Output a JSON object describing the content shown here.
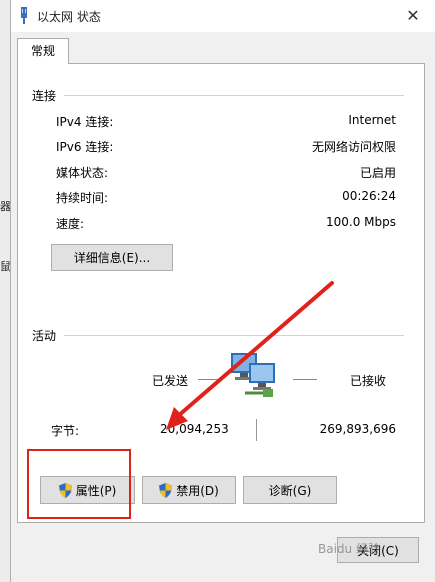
{
  "window": {
    "title": "以太网 状态",
    "close_glyph": "✕"
  },
  "tab": {
    "label": "常规"
  },
  "connection": {
    "heading": "连接",
    "rows": [
      {
        "label": "IPv4 连接:",
        "value": "Internet"
      },
      {
        "label": "IPv6 连接:",
        "value": "无网络访问权限"
      },
      {
        "label": "媒体状态:",
        "value": "已启用"
      },
      {
        "label": "持续时间:",
        "value": "00:26:24"
      },
      {
        "label": "速度:",
        "value": "100.0 Mbps"
      }
    ],
    "details_button": "详细信息(E)..."
  },
  "activity": {
    "heading": "活动",
    "sent_label": "已发送",
    "received_label": "已接收",
    "bytes_label": "字节:",
    "bytes_sent": "20,094,253",
    "bytes_received": "269,893,696"
  },
  "buttons": {
    "properties": "属性(P)",
    "disable": "禁用(D)",
    "diagnose": "诊断(G)",
    "close": "关闭(C)"
  },
  "background_chars": [
    "器",
    "鼠"
  ],
  "watermark": "Baidu 经验",
  "colors": {
    "annotation": "#e0231a",
    "shield_blue": "#2a6ac8",
    "shield_yellow": "#f2c01e"
  }
}
